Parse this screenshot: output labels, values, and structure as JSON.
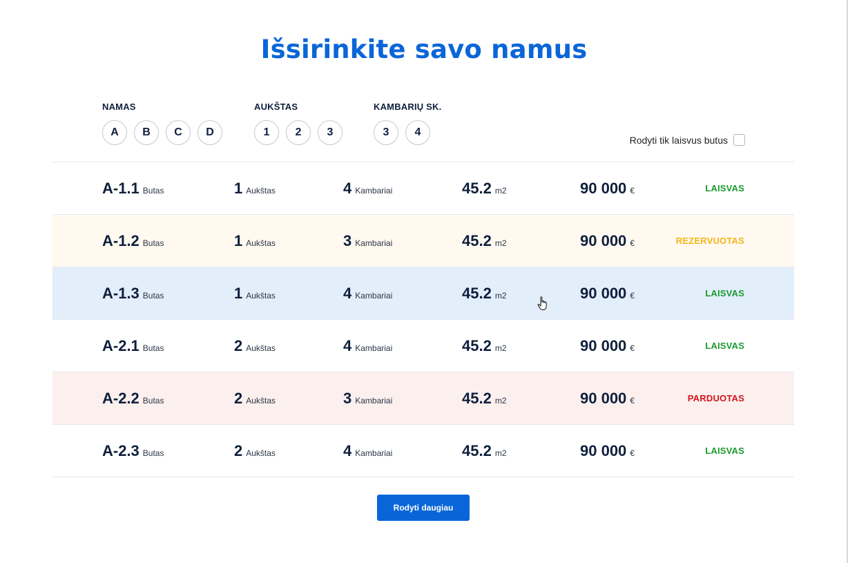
{
  "title": "Išsirinkite savo namus",
  "filters": {
    "namas": {
      "label": "NAMAS",
      "options": [
        "A",
        "B",
        "C",
        "D"
      ]
    },
    "aukstas": {
      "label": "AUKŠTAS",
      "options": [
        "1",
        "2",
        "3"
      ]
    },
    "kambariai": {
      "label": "KAMBARIŲ SK.",
      "options": [
        "3",
        "4"
      ]
    },
    "only_free_label": "Rodyti tik laisvus butus"
  },
  "units_labels": {
    "type": "Butas",
    "floor": "Aukštas",
    "rooms": "Kambariai",
    "area_unit": "m2",
    "currency": "€"
  },
  "status_colors": {
    "LAISVAS": "#1a9a2e",
    "REZERVUOTAS": "#f5b41a",
    "PARDUOTAS": "#d6141c"
  },
  "apartments": [
    {
      "id": "A-1.1",
      "floor": "1",
      "rooms": "4",
      "area": "45.2",
      "price": "90 000",
      "status": "LAISVAS"
    },
    {
      "id": "A-1.2",
      "floor": "1",
      "rooms": "3",
      "area": "45.2",
      "price": "90 000",
      "status": "REZERVUOTAS"
    },
    {
      "id": "A-1.3",
      "floor": "1",
      "rooms": "4",
      "area": "45.2",
      "price": "90 000",
      "status": "LAISVAS"
    },
    {
      "id": "A-2.1",
      "floor": "2",
      "rooms": "4",
      "area": "45.2",
      "price": "90 000",
      "status": "LAISVAS"
    },
    {
      "id": "A-2.2",
      "floor": "2",
      "rooms": "3",
      "area": "45.2",
      "price": "90 000",
      "status": "PARDUOTAS"
    },
    {
      "id": "A-2.3",
      "floor": "2",
      "rooms": "4",
      "area": "45.2",
      "price": "90 000",
      "status": "LAISVAS"
    }
  ],
  "more_button_label": "Rodyti daugiau"
}
